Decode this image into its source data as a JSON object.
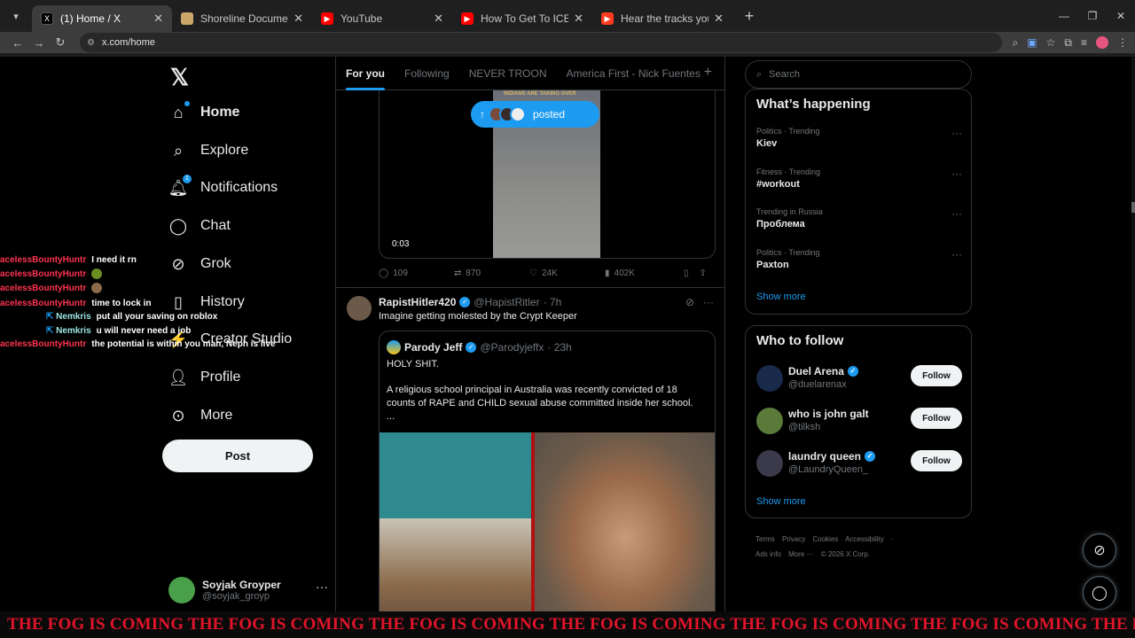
{
  "browser": {
    "tabs": [
      {
        "title": "(1) Home / X",
        "fav": "X",
        "fav_color": "#000000"
      },
      {
        "title": "Shoreline Document Spawn Ma",
        "fav": "",
        "fav_color": "#c9a86a"
      },
      {
        "title": "YouTube",
        "fav": "▶",
        "fav_color": "#ff0000"
      },
      {
        "title": "How To Get To ICEBREAKER In",
        "fav": "▶",
        "fav_color": "#ff0000"
      },
      {
        "title": "Hear the tracks you've liked: on",
        "fav": "▶",
        "fav_color": "#ff3b1f"
      }
    ],
    "url": "x.com/home"
  },
  "nav": {
    "items": [
      {
        "label": "Home",
        "icon": "home-icon"
      },
      {
        "label": "Explore",
        "icon": "search-icon"
      },
      {
        "label": "Notifications",
        "icon": "bell-icon",
        "badge": "1"
      },
      {
        "label": "Chat",
        "icon": "chat-icon"
      },
      {
        "label": "Grok",
        "icon": "grok-icon"
      },
      {
        "label": "History",
        "icon": "bookmark-icon"
      },
      {
        "label": "Creator Studio",
        "icon": "studio-icon"
      },
      {
        "label": "Profile",
        "icon": "person-icon"
      },
      {
        "label": "More",
        "icon": "more-circle-icon"
      }
    ],
    "post_label": "Post",
    "account": {
      "name": "Soyjak Groyper",
      "handle": "@soyjak_groyp"
    }
  },
  "chat_overlay": [
    {
      "user": "acelessBountyHuntr",
      "msg": "I need it rn"
    },
    {
      "user": "acelessBountyHuntr",
      "msg": ""
    },
    {
      "user": "acelessBountyHuntr",
      "msg": ""
    },
    {
      "user": "acelessBountyHuntr",
      "msg": "time to lock in"
    },
    {
      "user": "Nemkris",
      "msg": "put all your saving on roblox"
    },
    {
      "user": "Nemkris",
      "msg": "u will never need a job"
    },
    {
      "user": "acelessBountyHuntr",
      "msg": "the potential is within you man, Neph is live"
    }
  ],
  "feed": {
    "tabs": [
      "For you",
      "Following",
      "NEVER TROON",
      "America First - Nick Fuentes"
    ],
    "posted_label": "posted",
    "video": {
      "caption": "INDIANS ARE TAKING OVER",
      "time": "0:03"
    },
    "actions": {
      "replies": "109",
      "reposts": "870",
      "likes": "24K",
      "views": "402K"
    },
    "tweet": {
      "name": "RapistHitler420",
      "handle": "@HapistRitler",
      "time": "· 7h",
      "text": "Imagine getting molested by the Crypt Keeper",
      "quote": {
        "name": "Parody Jeff",
        "handle": "@Parodyjeffx",
        "time": "· 23h",
        "line1": "HOLY SHIT.",
        "line2": "A religious school principal in Australia was recently convicted of 18 counts of RAPE and CHILD sexual abuse committed inside her school.",
        "line3": "..."
      }
    }
  },
  "sidebar": {
    "search_placeholder": "Search",
    "happening_title": "What’s happening",
    "trends": [
      {
        "context": "Politics · Trending",
        "title": "Kiev"
      },
      {
        "context": "Fitness · Trending",
        "title": "#workout"
      },
      {
        "context": "Trending in Russia",
        "title": "Проблема"
      },
      {
        "context": "Politics · Trending",
        "title": "Paxton"
      }
    ],
    "show_more": "Show more",
    "follow_title": "Who to follow",
    "follow": [
      {
        "name": "Duel Arena",
        "handle": "@duelarenax",
        "verified": true,
        "color": "#1a2a4a",
        "button": "Follow"
      },
      {
        "name": "who is john galt",
        "handle": "@tilksh",
        "verified": false,
        "color": "#5a7a3a",
        "button": "Follow"
      },
      {
        "name": "laundry queen",
        "handle": "@LaundryQueen_",
        "verified": true,
        "color": "#3a3a4a",
        "button": "Follow"
      }
    ],
    "footer": {
      "line1": [
        "Terms",
        "Privacy",
        "Cookies",
        "Accessibility",
        "·"
      ],
      "line2": [
        "Ads info",
        "More ···",
        "© 2026 X Corp."
      ]
    }
  },
  "banner": "THE FOG IS COMING THE FOG IS COMING THE FOG IS COMING THE FOG IS COMING THE FOG IS COMING THE FOG IS COMING THE FOG IS COMING THE FOG IS COMING THE FOG IS COMING"
}
